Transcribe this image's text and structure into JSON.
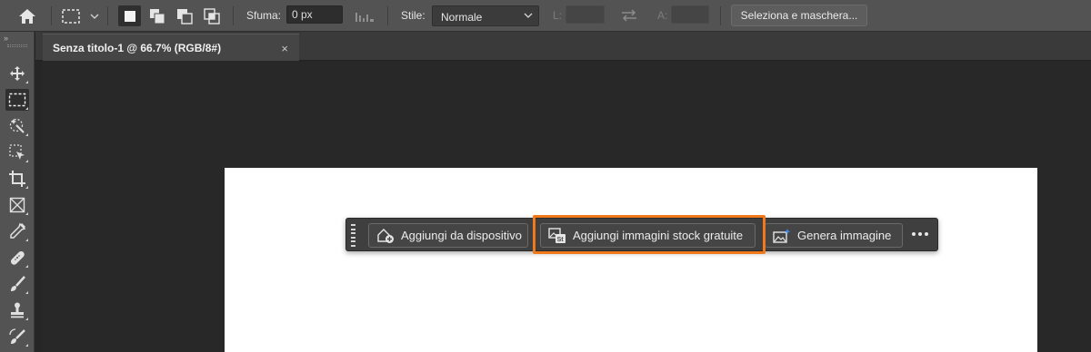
{
  "options_bar": {
    "home_icon": "home-icon",
    "tool_icon": "rectangular-marquee-icon",
    "selection_modes": [
      "new-selection-icon",
      "add-to-selection-icon",
      "subtract-from-selection-icon",
      "intersect-selection-icon"
    ],
    "feather_label": "Sfuma:",
    "feather_value": "0 px",
    "antialias_icon": "anti-alias-icon",
    "style_label": "Stile:",
    "style_value": "Normale",
    "width_label": "L:",
    "width_value": "",
    "swap_icon": "swap-width-height-icon",
    "height_label": "A:",
    "height_value": "",
    "select_mask_label": "Seleziona e maschera..."
  },
  "toolbar": {
    "collapse_glyph": "»",
    "tools": [
      {
        "name": "move-tool",
        "icon": "move-icon",
        "active": false
      },
      {
        "name": "rectangular-marquee-tool",
        "icon": "marquee-icon",
        "active": true
      },
      {
        "name": "object-selection-tool",
        "icon": "object-selection-icon",
        "active": false
      },
      {
        "name": "crop-select-tool",
        "icon": "artboard-icon",
        "active": false
      },
      {
        "name": "crop-tool",
        "icon": "crop-icon",
        "active": false
      },
      {
        "name": "frame-tool",
        "icon": "frame-icon",
        "active": false
      },
      {
        "name": "eyedropper-tool",
        "icon": "eyedropper-icon",
        "active": false
      },
      {
        "name": "healing-brush-tool",
        "icon": "bandage-icon",
        "active": false
      },
      {
        "name": "brush-tool",
        "icon": "brush-icon",
        "active": false
      },
      {
        "name": "clone-stamp-tool",
        "icon": "stamp-icon",
        "active": false
      },
      {
        "name": "history-brush-tool",
        "icon": "history-brush-icon",
        "active": false
      }
    ]
  },
  "document_tab": {
    "title": "Senza titolo-1 @ 66.7% (RGB/8#)",
    "close_glyph": "×"
  },
  "task_bar": {
    "add_from_device_label": "Aggiungi da dispositivo",
    "add_stock_label": "Aggiungi immagini stock gratuite",
    "generate_image_label": "Genera immagine",
    "highlight_color": "#f07a1b"
  }
}
